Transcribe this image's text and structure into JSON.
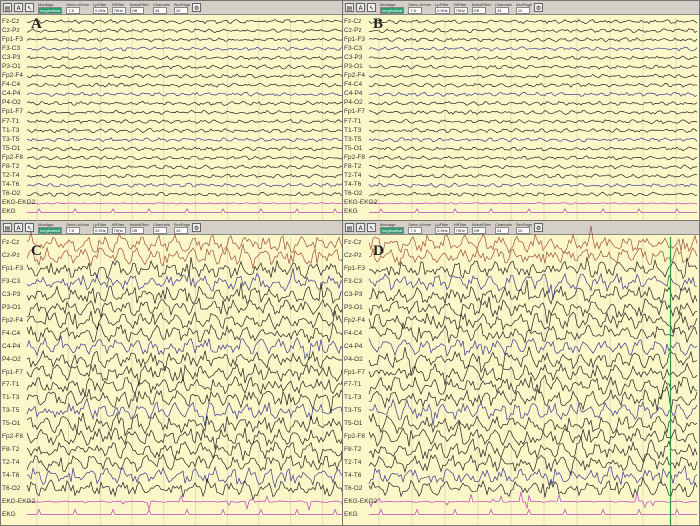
{
  "toolbar": {
    "labels": [
      "Montage",
      "Sens uV/mm",
      "LpFilter",
      "HfFilter",
      "NotchFilter",
      "Channels",
      "SecPage"
    ],
    "values": [
      "longitudinal",
      "7.5",
      "0.5Hz",
      "70Hz",
      "Off",
      "24",
      "10"
    ]
  },
  "panels": [
    {
      "label": "A",
      "kind": "normal",
      "channels": [
        "Fz-Cz",
        "Cz-Pz",
        "Fp1-F3",
        "F3-C3",
        "C3-P3",
        "P3-O1",
        "Fp2-F4",
        "F4-C4",
        "C4-P4",
        "P4-O2",
        "Fp1-F7",
        "F7-T1",
        "T1-T3",
        "T3-T5",
        "T5-O1",
        "Fp2-F8",
        "F8-T2",
        "T2-T4",
        "T4-T6",
        "T6-O2",
        "EKG-EKG2",
        "EKG"
      ]
    },
    {
      "label": "B",
      "kind": "normal",
      "channels": [
        "Fz-Cz",
        "Cz-Pz",
        "Fp1-F3",
        "F3-C3",
        "C3-P3",
        "P3-O1",
        "Fp2-F4",
        "F4-C4",
        "C4-P4",
        "P4-O2",
        "Fp1-F7",
        "F7-T1",
        "T1-T3",
        "T3-T5",
        "T5-O1",
        "Fp2-F8",
        "F8-T2",
        "T2-T4",
        "T4-T6",
        "T6-O2",
        "EKG-EKG2",
        "EKG"
      ]
    },
    {
      "label": "C",
      "kind": "seizure",
      "channels": [
        "Fz-Cz",
        "Cz-Pz",
        "Fp1-F3",
        "F3-C3",
        "C3-P3",
        "P3-O1",
        "Fp2-F4",
        "F4-C4",
        "C4-P4",
        "P4-O2",
        "Fp1-F7",
        "F7-T1",
        "T1-T3",
        "T3-T5",
        "T5-O1",
        "Fp2-F8",
        "F8-T2",
        "T2-T4",
        "T4-T6",
        "T6-O2",
        "EKG-EKG2",
        "EKG"
      ]
    },
    {
      "label": "D",
      "kind": "seizure",
      "channels": [
        "Fz-Cz",
        "Cz-Pz",
        "Fp1-F3",
        "F3-C3",
        "C3-P3",
        "P3-O1",
        "Fp2-F4",
        "F4-C4",
        "C4-P4",
        "P4-O2",
        "Fp1-F7",
        "F7-T1",
        "T1-T3",
        "T3-T5",
        "T5-O1",
        "Fp2-F8",
        "F8-T2",
        "T2-T4",
        "T4-T6",
        "T6-O2",
        "EKG-EKG2",
        "EKG"
      ]
    }
  ],
  "colors": {
    "background": "#fbf7c8",
    "grid": "#c9c6a8",
    "frontal": "#a0503a",
    "trace": "#222222",
    "blue": "#3a3a8a",
    "ekg": "#c040c0",
    "marker": "#2e9b3a"
  }
}
